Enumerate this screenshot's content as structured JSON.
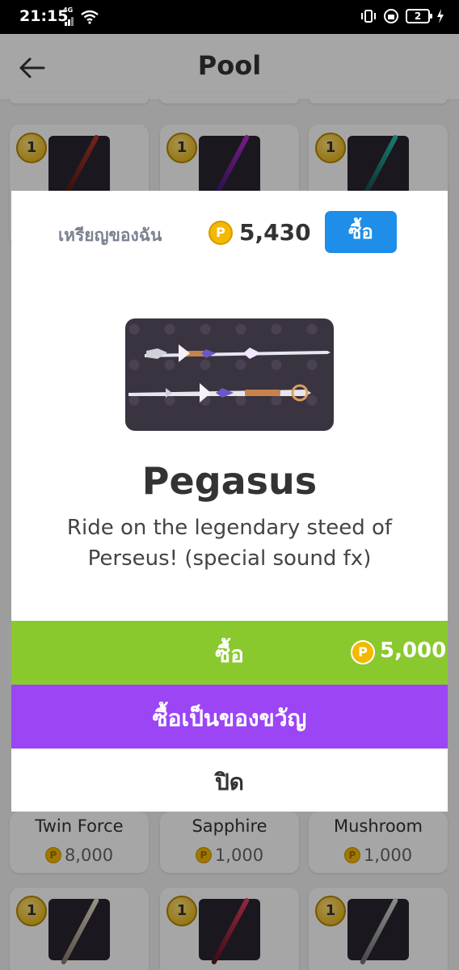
{
  "status_bar": {
    "time": "21:15",
    "network": "4G",
    "battery": "2"
  },
  "app_bar": {
    "title": "Pool"
  },
  "grid": {
    "top_row": [
      {
        "badge": "1"
      },
      {
        "badge": "1"
      },
      {
        "badge": "1"
      }
    ],
    "named_row": [
      {
        "name": "Twin Force",
        "price": "8,000"
      },
      {
        "name": "Sapphire",
        "price": "1,000"
      },
      {
        "name": "Mushroom",
        "price": "1,000"
      }
    ],
    "bottom_row": [
      {
        "badge": "1"
      },
      {
        "badge": "1"
      },
      {
        "badge": "1"
      }
    ],
    "coin_symbol": "P"
  },
  "dialog": {
    "my_coins_label": "เหรียญของฉัน",
    "coin_symbol": "P",
    "coin_balance": "5,430",
    "header_buy_label": "ซื้อ",
    "item_title": "Pegasus",
    "item_description": "Ride on the legendary steed of Perseus! (special sound fx)",
    "buy_label": "ซื้อ",
    "buy_price": "5,000",
    "gift_label": "ซื้อเป็นของขวัญ",
    "close_label": "ปิด"
  },
  "colors": {
    "buy_green": "#8ac92e",
    "gift_purple": "#9b45f5",
    "header_button_blue": "#1e8ee8",
    "coin_gold": "#f5b800"
  },
  "icons": [
    "back-arrow-icon",
    "coin-icon",
    "wifi-icon",
    "signal-icon",
    "battery-icon"
  ]
}
